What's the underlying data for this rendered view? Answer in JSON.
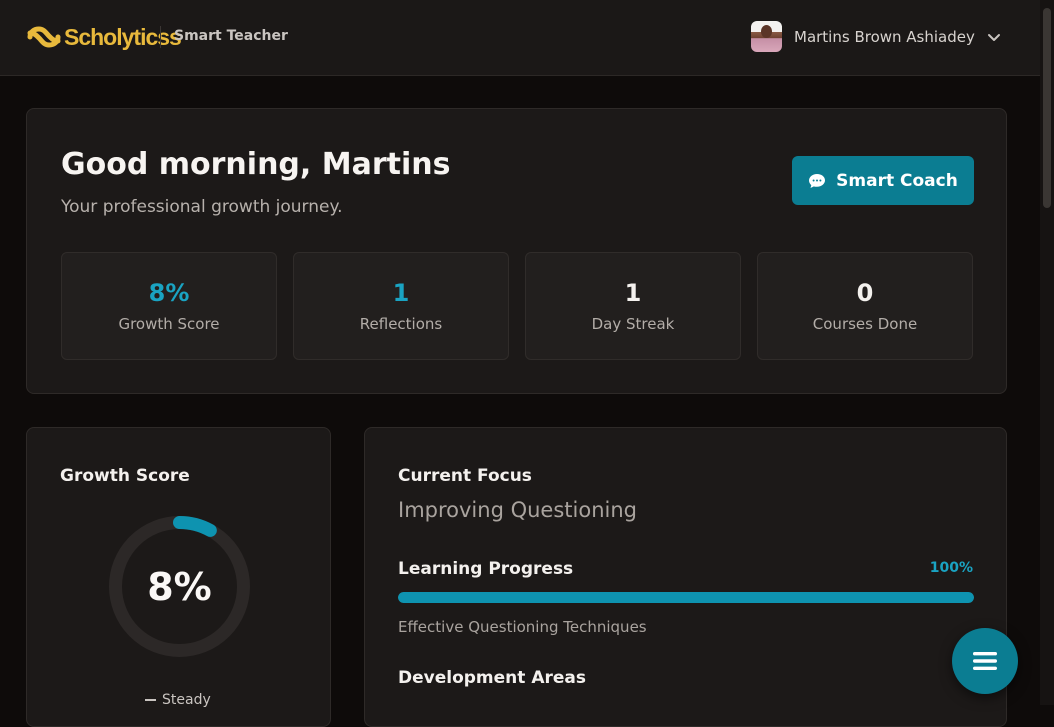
{
  "header": {
    "brand": "Scholyticss",
    "product": "Smart Teacher",
    "user_name": "Martins Brown Ashiadey"
  },
  "hero": {
    "greeting": "Good morning, Martins",
    "subtitle": "Your professional growth journey.",
    "coach_button": "Smart Coach",
    "stats": [
      {
        "value": "8%",
        "label": "Growth Score"
      },
      {
        "value": "1",
        "label": "Reflections"
      },
      {
        "value": "1",
        "label": "Day Streak"
      },
      {
        "value": "0",
        "label": "Courses Done"
      }
    ]
  },
  "growth": {
    "title": "Growth Score",
    "score": "8%",
    "score_fraction": 0.08,
    "trend": "Steady"
  },
  "focus": {
    "title": "Current Focus",
    "value": "Improving Questioning",
    "progress_title": "Learning Progress",
    "progress_pct": "100%",
    "progress_fraction": 1.0,
    "course": "Effective Questioning Techniques",
    "dev_title": "Development Areas"
  },
  "colors": {
    "accent": "#0b7d92",
    "accent_text": "#1aa3c2",
    "brand": "#e8b93c",
    "background": "#0e0b0a",
    "card": "#1c1918"
  },
  "icons": {
    "coach": "chat-bubble-icon",
    "menu": "hamburger-menu-icon",
    "user_menu": "chevron-down-icon"
  }
}
